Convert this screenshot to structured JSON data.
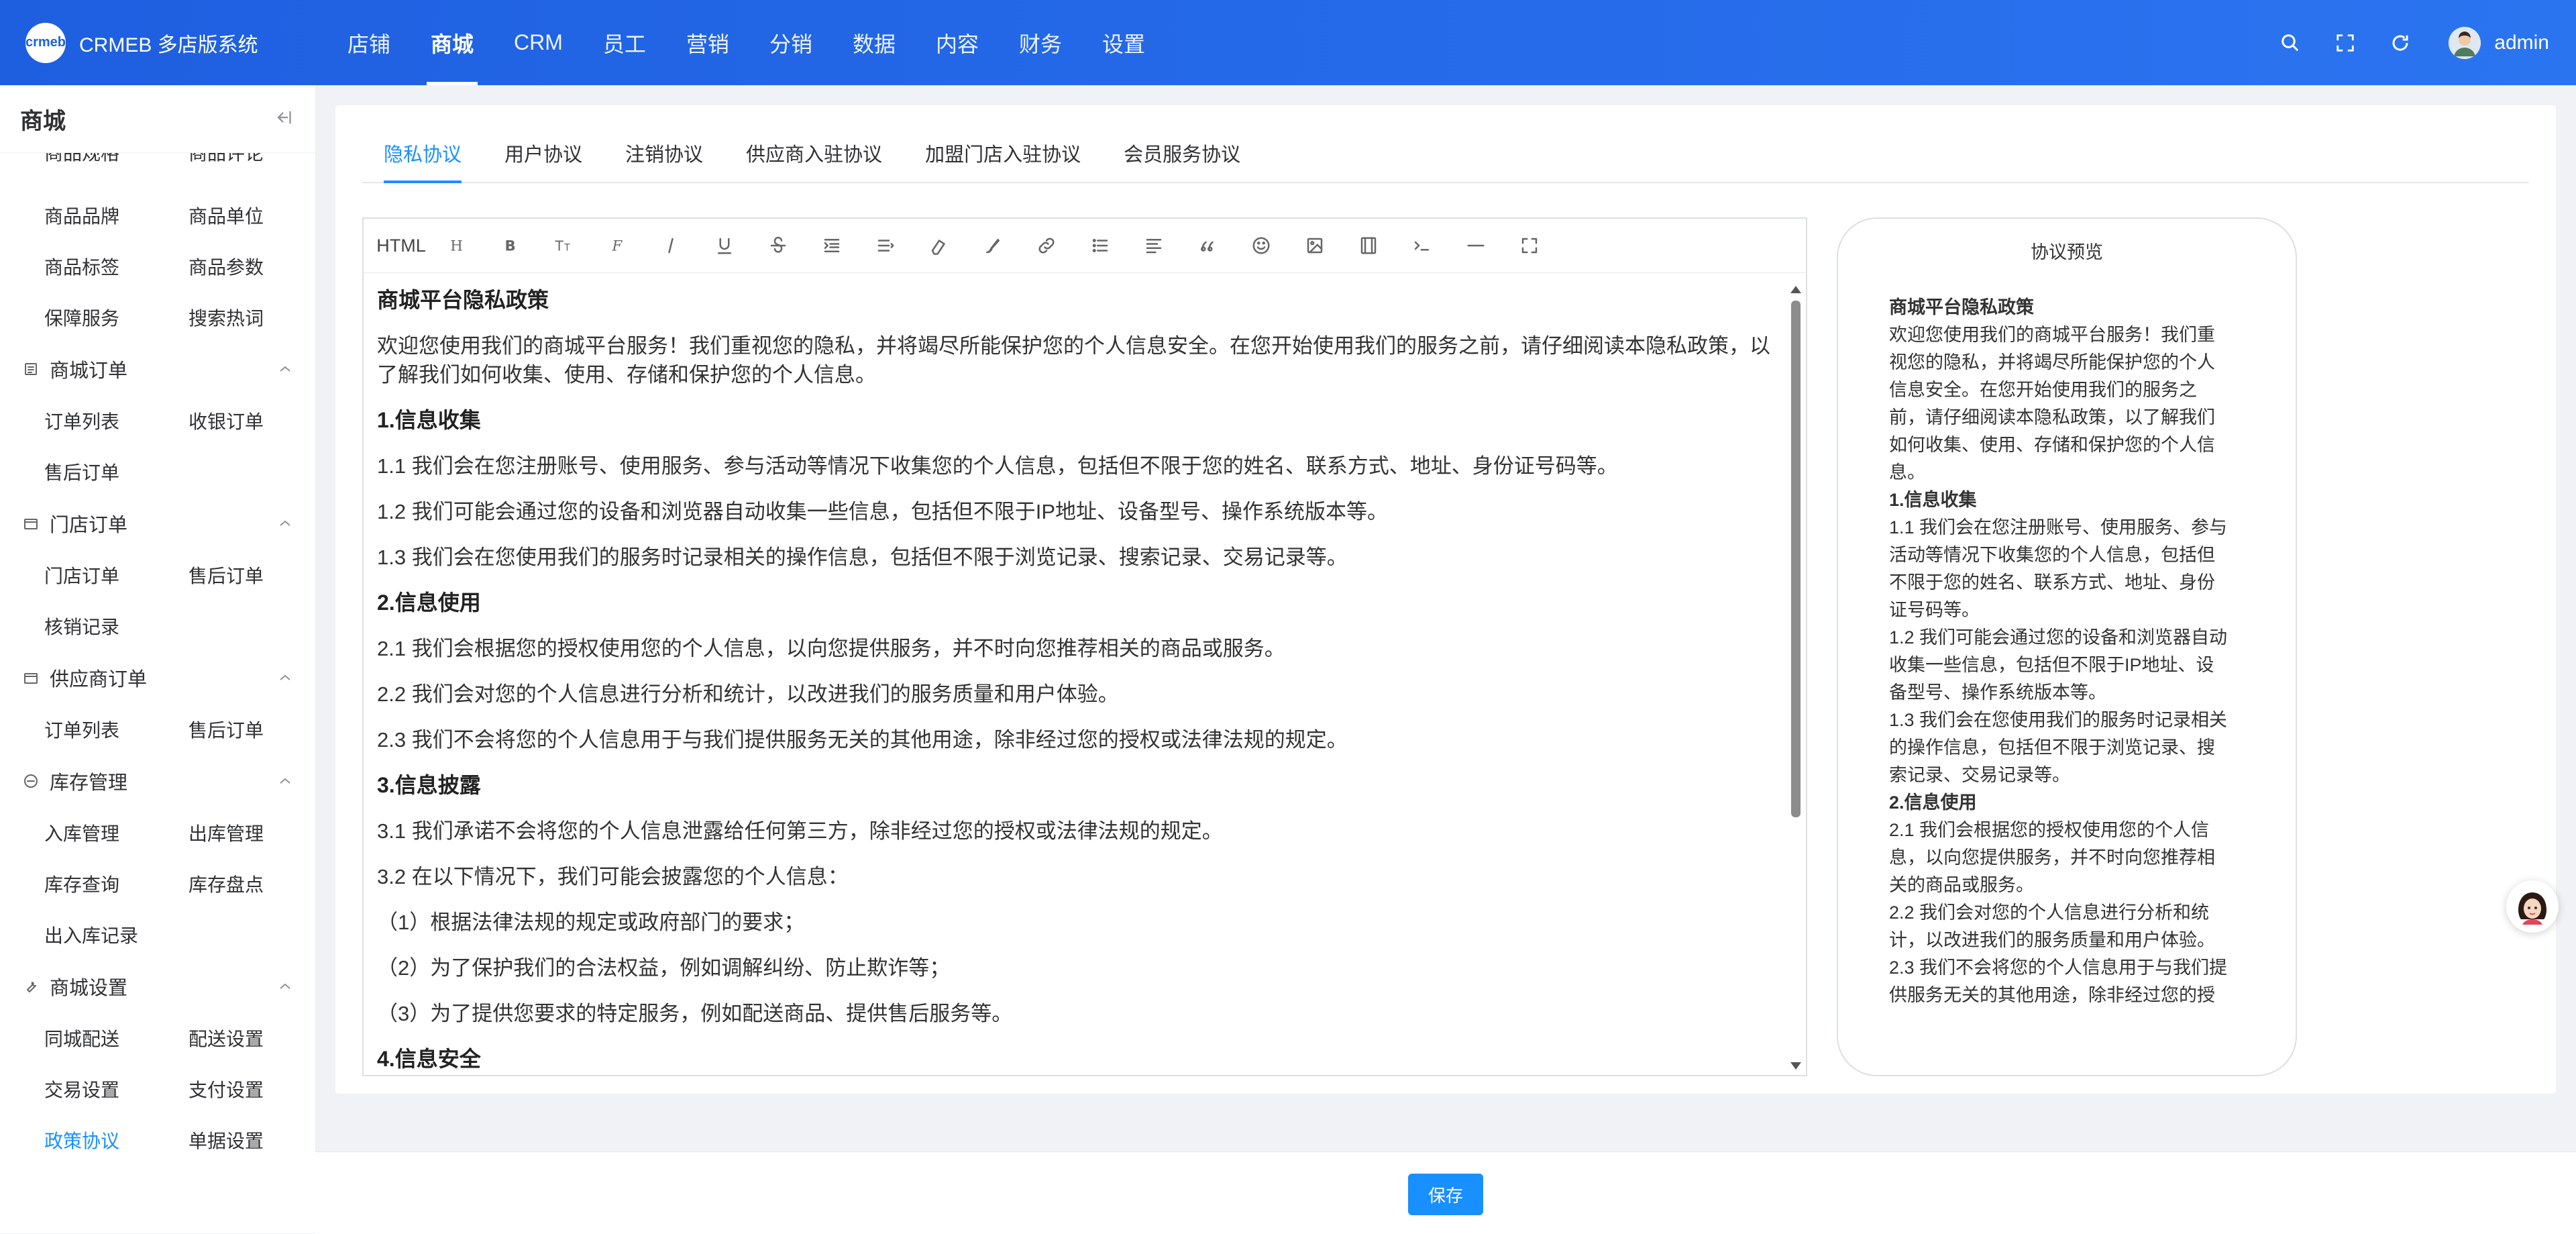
{
  "header": {
    "logo_text": "crmeb",
    "app_title": "CRMEB 多店版系统",
    "nav": [
      {
        "label": "店铺"
      },
      {
        "label": "商城"
      },
      {
        "label": "CRM"
      },
      {
        "label": "员工"
      },
      {
        "label": "营销"
      },
      {
        "label": "分销"
      },
      {
        "label": "数据"
      },
      {
        "label": "内容"
      },
      {
        "label": "财务"
      },
      {
        "label": "设置"
      }
    ],
    "active_nav": "商城",
    "icons": [
      "search-icon",
      "fullscreen-icon",
      "refresh-icon"
    ],
    "user": "admin"
  },
  "sidebar": {
    "title": "商城",
    "clipped_row": [
      "商品规格",
      "商品评论"
    ],
    "top_links": [
      "商品品牌",
      "商品单位",
      "商品标签",
      "商品参数",
      "保障服务",
      "搜索热词"
    ],
    "groups": [
      {
        "name": "商城订单",
        "icon": "order-list-icon",
        "links": [
          "订单列表",
          "收银订单",
          "售后订单"
        ]
      },
      {
        "name": "门店订单",
        "icon": "store-order-icon",
        "links": [
          "门店订单",
          "售后订单",
          "核销记录"
        ]
      },
      {
        "name": "供应商订单",
        "icon": "supplier-order-icon",
        "links": [
          "订单列表",
          "售后订单"
        ]
      },
      {
        "name": "库存管理",
        "icon": "inventory-icon",
        "links": [
          "入库管理",
          "出库管理",
          "库存查询",
          "库存盘点",
          "出入库记录"
        ]
      },
      {
        "name": "商城设置",
        "icon": "settings-wrench-icon",
        "links": [
          "同城配送",
          "配送设置",
          "交易设置",
          "支付设置",
          "政策协议",
          "单据设置"
        ]
      }
    ],
    "active_link": "政策协议"
  },
  "tabs": [
    {
      "label": "隐私协议"
    },
    {
      "label": "用户协议"
    },
    {
      "label": "注销协议"
    },
    {
      "label": "供应商入驻协议"
    },
    {
      "label": "加盟门店入驻协议"
    },
    {
      "label": "会员服务协议"
    }
  ],
  "active_tab": "隐私协议",
  "toolbar": {
    "html_label": "HTML",
    "buttons": [
      "heading-icon",
      "bold-icon",
      "font-size-icon",
      "font-family-icon",
      "italic-icon",
      "underline-icon",
      "strikethrough-icon",
      "indent-icon",
      "line-height-icon",
      "clear-format-icon",
      "text-color-icon",
      "link-icon",
      "bullet-list-icon",
      "align-icon",
      "quote-icon",
      "emoji-icon",
      "image-icon",
      "video-icon",
      "code-icon",
      "divider-icon",
      "fullscreen-icon"
    ]
  },
  "editor": {
    "paragraphs": [
      {
        "text": "商城平台隐私政策",
        "h": true
      },
      {
        "text": "欢迎您使用我们的商城平台服务！我们重视您的隐私，并将竭尽所能保护您的个人信息安全。在您开始使用我们的服务之前，请仔细阅读本隐私政策，以了解我们如何收集、使用、存储和保护您的个人信息。"
      },
      {
        "text": "1.信息收集",
        "h": true
      },
      {
        "text": "1.1 我们会在您注册账号、使用服务、参与活动等情况下收集您的个人信息，包括但不限于您的姓名、联系方式、地址、身份证号码等。"
      },
      {
        "text": "1.2 我们可能会通过您的设备和浏览器自动收集一些信息，包括但不限于IP地址、设备型号、操作系统版本等。"
      },
      {
        "text": "1.3 我们会在您使用我们的服务时记录相关的操作信息，包括但不限于浏览记录、搜索记录、交易记录等。"
      },
      {
        "text": "2.信息使用",
        "h": true
      },
      {
        "text": "2.1 我们会根据您的授权使用您的个人信息，以向您提供服务，并不时向您推荐相关的商品或服务。"
      },
      {
        "text": "2.2 我们会对您的个人信息进行分析和统计，以改进我们的服务质量和用户体验。"
      },
      {
        "text": "2.3 我们不会将您的个人信息用于与我们提供服务无关的其他用途，除非经过您的授权或法律法规的规定。"
      },
      {
        "text": "3.信息披露",
        "h": true
      },
      {
        "text": "3.1 我们承诺不会将您的个人信息泄露给任何第三方，除非经过您的授权或法律法规的规定。"
      },
      {
        "text": "3.2 在以下情况下，我们可能会披露您的个人信息："
      },
      {
        "text": "（1）根据法律法规的规定或政府部门的要求；"
      },
      {
        "text": "（2）为了保护我们的合法权益，例如调解纠纷、防止欺诈等；"
      },
      {
        "text": "（3）为了提供您要求的特定服务，例如配送商品、提供售后服务等。"
      },
      {
        "text": "4.信息安全",
        "h": true
      }
    ],
    "scroll_position": 0.0
  },
  "preview": {
    "title": "协议预览",
    "lines": [
      {
        "text": "商城平台隐私政策",
        "h": true
      },
      {
        "text": "欢迎您使用我们的商城平台服务！我们重"
      },
      {
        "text": "视您的隐私，并将竭尽所能保护您的个人"
      },
      {
        "text": "信息安全。在您开始使用我们的服务之"
      },
      {
        "text": "前，请仔细阅读本隐私政策，以了解我们"
      },
      {
        "text": "如何收集、使用、存储和保护您的个人信"
      },
      {
        "text": "息。"
      },
      {
        "text": "1.信息收集",
        "h": true
      },
      {
        "text": "1.1 我们会在您注册账号、使用服务、参与"
      },
      {
        "text": "活动等情况下收集您的个人信息，包括但"
      },
      {
        "text": "不限于您的姓名、联系方式、地址、身份"
      },
      {
        "text": "证号码等。"
      },
      {
        "text": "1.2 我们可能会通过您的设备和浏览器自动"
      },
      {
        "text": "收集一些信息，包括但不限于IP地址、设"
      },
      {
        "text": "备型号、操作系统版本等。"
      },
      {
        "text": "1.3 我们会在您使用我们的服务时记录相关"
      },
      {
        "text": "的操作信息，包括但不限于浏览记录、搜"
      },
      {
        "text": "索记录、交易记录等。"
      },
      {
        "text": "2.信息使用",
        "h": true
      },
      {
        "text": "2.1 我们会根据您的授权使用您的个人信"
      },
      {
        "text": "息，以向您提供服务，并不时向您推荐相"
      },
      {
        "text": "关的商品或服务。"
      },
      {
        "text": "2.2 我们会对您的个人信息进行分析和统"
      },
      {
        "text": "计，以改进我们的服务质量和用户体验。"
      },
      {
        "text": "2.3 我们不会将您的个人信息用于与我们提"
      },
      {
        "text": "供服务无关的其他用途，除非经过您的授"
      }
    ]
  },
  "footer": {
    "save_label": "保存"
  },
  "colors": {
    "header": "#2266e6",
    "accent": "#1890ff",
    "page_bg": "#f0f2f5"
  }
}
